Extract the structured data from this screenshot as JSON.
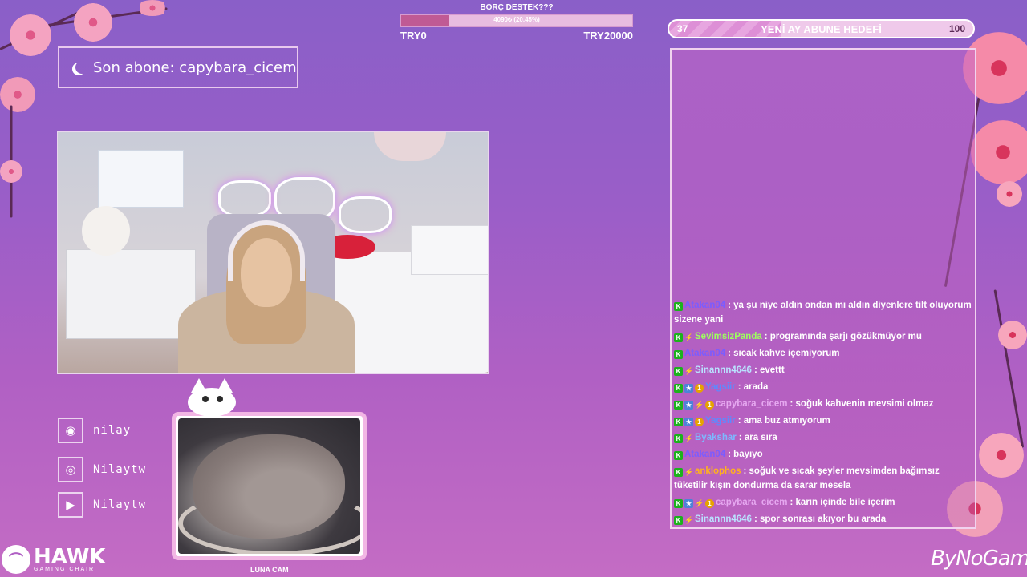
{
  "donation": {
    "title": "BORÇ DESTEK???",
    "progress_text": "4090₺ (20.45%)",
    "progress_fraction": 0.2045,
    "min_label": "TRY0",
    "max_label": "TRY20000"
  },
  "sub_goal": {
    "label": "YENİ AY ABUNE HEDEFİ",
    "current": "37",
    "target": "100",
    "progress_fraction": 0.37
  },
  "last_sub": {
    "text": "Son abone: capybara_cicem"
  },
  "socials": [
    {
      "icon": "discord-icon",
      "name": "nilay"
    },
    {
      "icon": "instagram-icon",
      "name": "Nilaytw"
    },
    {
      "icon": "youtube-icon",
      "name": "Nilaytw"
    }
  ],
  "cat_cam": {
    "label": "LUNA CAM"
  },
  "chat": {
    "messages": [
      {
        "badges": [
          "mod"
        ],
        "user": "Atakan04",
        "color": "#7b5cff",
        "text": ": ya şu niye aldın ondan mı aldın diyenlere tilt oluyorum sizene yani"
      },
      {
        "badges": [
          "mod",
          "tw"
        ],
        "user": "SevimsizPanda",
        "color": "#9dff5e",
        "text": ": programında şarjı gözükmüyor mu"
      },
      {
        "badges": [
          "mod"
        ],
        "user": "Atakan04",
        "color": "#7b5cff",
        "text": ": sıcak kahve içemiyorum"
      },
      {
        "badges": [
          "mod",
          "tw"
        ],
        "user": "Sinannn4646",
        "color": "#b9e3ff",
        "text": ": evettt"
      },
      {
        "badges": [
          "mod",
          "sub",
          "gold"
        ],
        "user": "Yagsiir",
        "color": "#5b8bff",
        "text": ": arada"
      },
      {
        "badges": [
          "mod",
          "sub",
          "tw",
          "gold"
        ],
        "user": "capybara_cicem",
        "color": "#e6a8f0",
        "text": ": soğuk kahvenin mevsimi olmaz"
      },
      {
        "badges": [
          "mod",
          "sub",
          "gold"
        ],
        "user": "Yagsiir",
        "color": "#5b8bff",
        "text": ": ama buz atmıyorum"
      },
      {
        "badges": [
          "mod",
          "tw"
        ],
        "user": "Byakshar",
        "color": "#7db9ff",
        "text": ": ara sıra"
      },
      {
        "badges": [
          "mod"
        ],
        "user": "Atakan04",
        "color": "#7b5cff",
        "text": ": bayıyo"
      },
      {
        "badges": [
          "mod",
          "tw"
        ],
        "user": "anklophos",
        "color": "#ffb020",
        "text": ": soğuk ve sıcak şeyler mevsimden bağımsız tüketilir kışın dondurma da sarar mesela"
      },
      {
        "badges": [
          "mod",
          "sub",
          "tw",
          "gold"
        ],
        "user": "capybara_cicem",
        "color": "#e6a8f0",
        "text": ": karın içinde bile içerim"
      },
      {
        "badges": [
          "mod",
          "tw"
        ],
        "user": "Sinannn4646",
        "color": "#b9e3ff",
        "text": ": spor sonrası akıyor bu arada"
      }
    ]
  },
  "logos": {
    "hawk_title": "HAWK",
    "hawk_sub": "GAMING CHAIR",
    "bynogame": "ByNoGame"
  },
  "colors": {
    "background_top": "#8a5fc8",
    "background_bottom": "#c46cc4",
    "accent_pink": "#f2a6c0",
    "bar_fill": "#c05a94"
  }
}
